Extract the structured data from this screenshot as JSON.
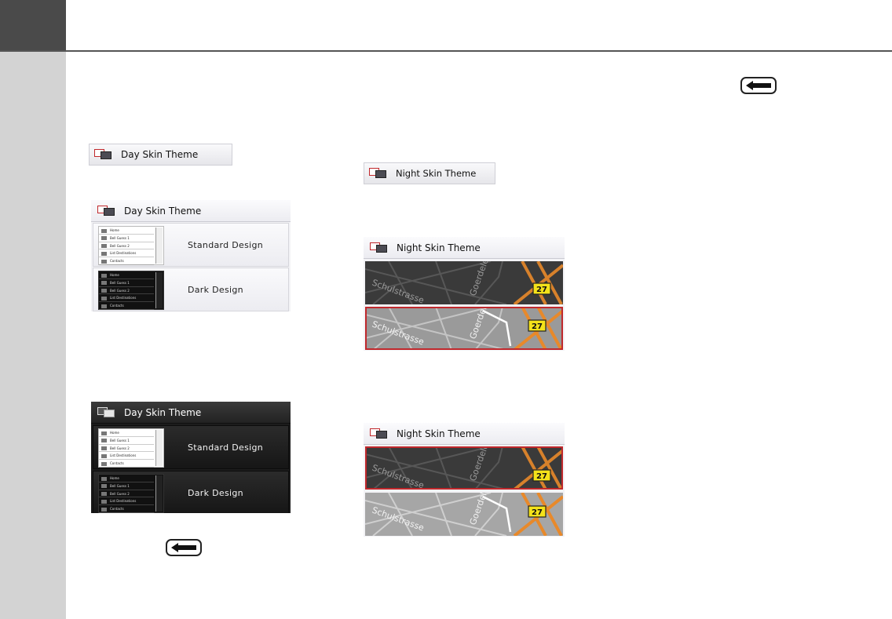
{
  "day": {
    "button_label": "Day Skin Theme",
    "panel_title": "Day Skin Theme",
    "options": [
      {
        "label": "Standard Design",
        "thumb": "light"
      },
      {
        "label": "Dark Design",
        "thumb": "dark"
      }
    ],
    "thumb_items": [
      "Home",
      "Bell Guess 1",
      "Bell Guess 2",
      "List Destinations",
      "Contacts"
    ]
  },
  "night": {
    "button_label": "Night Skin Theme",
    "panel_title": "Night Skin Theme",
    "map_labels": {
      "street1": "Schulstrasse",
      "street2": "Goerdeler",
      "road_badge": "27"
    }
  },
  "colors": {
    "accent": "#c0282c",
    "sidebar": "#d3d3d3",
    "corner": "#4a4a4a",
    "road": "#e8892a",
    "badge": "#f4e21a"
  },
  "icons": {
    "back": "back-arrow-icon",
    "theme": "skin-theme-icon"
  }
}
